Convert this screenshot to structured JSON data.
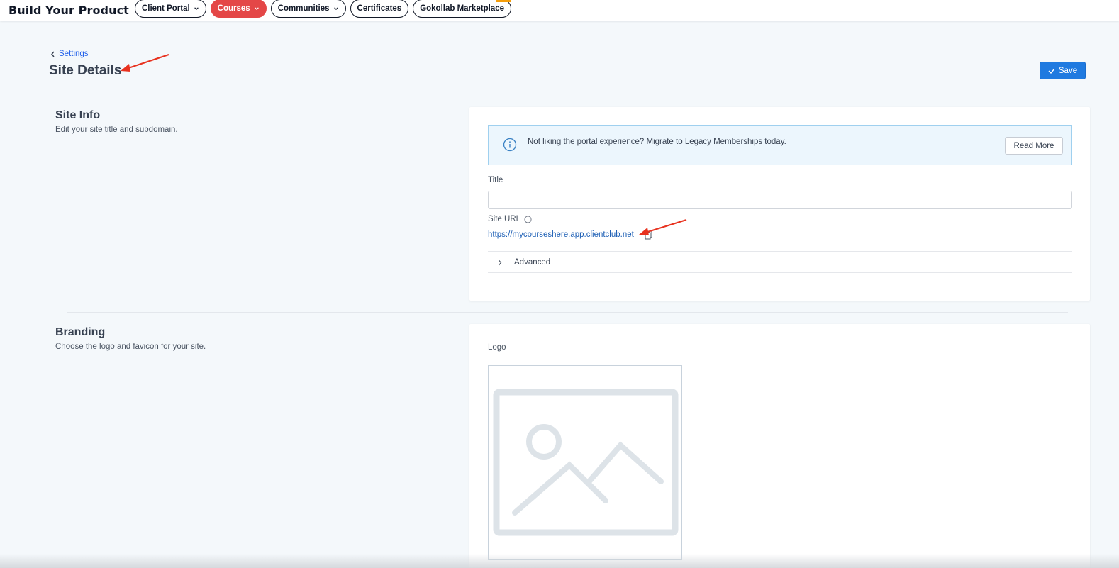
{
  "topnav": {
    "brand": "Build Your Product",
    "items": [
      {
        "label": "Client Portal",
        "dropdown": true,
        "active": false
      },
      {
        "label": "Courses",
        "dropdown": true,
        "active": true
      },
      {
        "label": "Communities",
        "dropdown": true,
        "active": false
      },
      {
        "label": "Certificates",
        "dropdown": false,
        "active": false
      },
      {
        "label": "Gokollab Marketplace",
        "dropdown": false,
        "active": false,
        "badge": true
      }
    ],
    "active_color": "#e44747"
  },
  "header": {
    "back_label": "Settings",
    "title": "Site Details",
    "save_label": "Save"
  },
  "site_info": {
    "title": "Site Info",
    "description": "Edit your site title and subdomain.",
    "banner_text": "Not liking the portal experience? Migrate to Legacy Memberships today.",
    "banner_button": "Read More",
    "title_label": "Title",
    "title_value": "",
    "site_url_label": "Site URL",
    "site_url": "https://mycourseshere.app.clientclub.net",
    "advanced_label": "Advanced"
  },
  "branding": {
    "title": "Branding",
    "description": "Choose the logo and favicon for your site.",
    "logo_label": "Logo"
  },
  "colors": {
    "primary": "#1f7ae0",
    "link": "#1d5fb5",
    "annotation_arrow": "#e8321f"
  }
}
